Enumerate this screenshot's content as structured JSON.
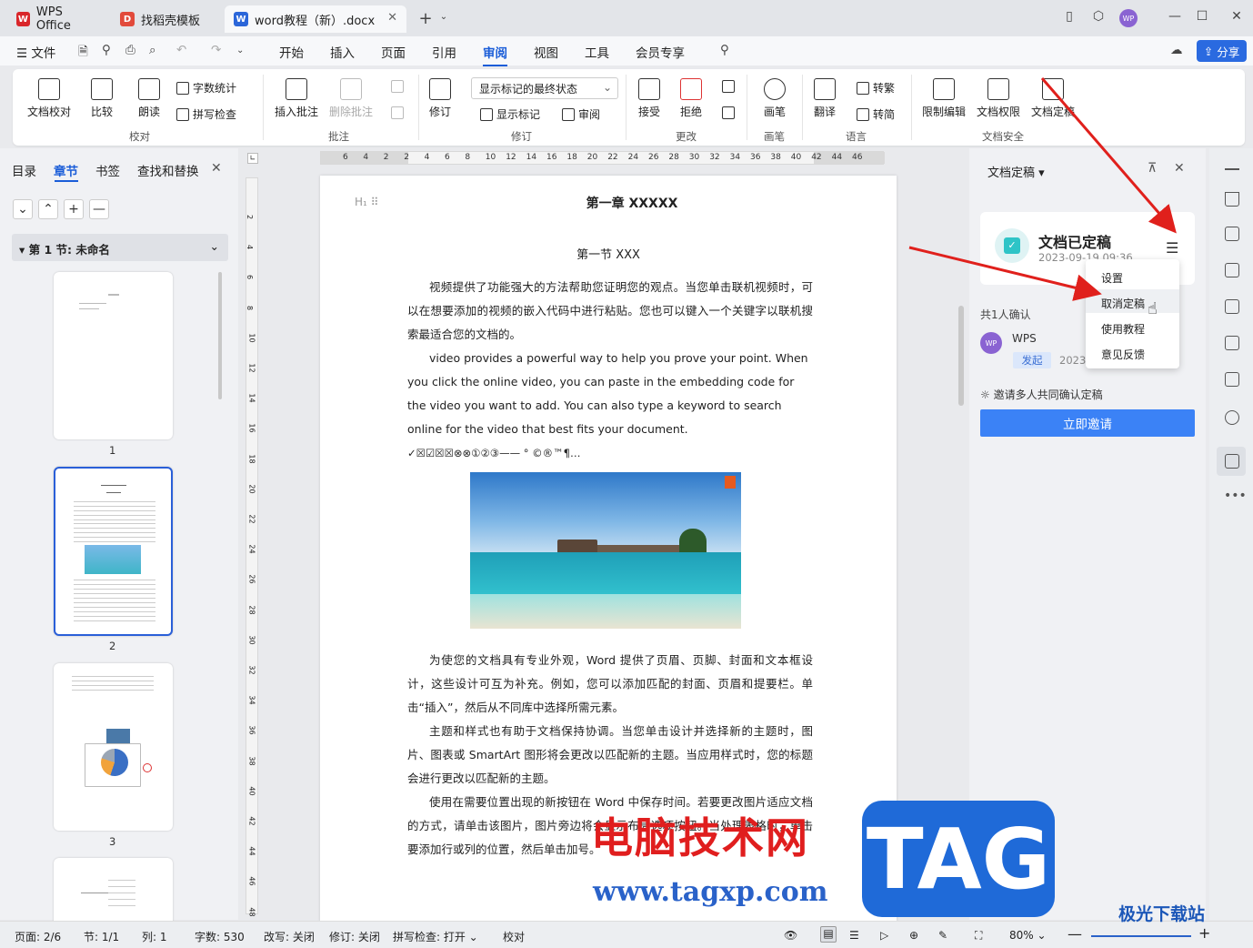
{
  "tabs": [
    {
      "label": "WPS Office",
      "icon": "wps-logo-icon"
    },
    {
      "label": "找稻壳模板",
      "icon": "docer-icon"
    },
    {
      "label": "word教程（新）.docx",
      "icon": "word-doc-icon"
    }
  ],
  "menu": {
    "file": "文件",
    "items": [
      "开始",
      "插入",
      "页面",
      "引用",
      "审阅",
      "视图",
      "工具",
      "会员专享"
    ],
    "active": "审阅",
    "share": "分享"
  },
  "ribbon": {
    "doc_check": "文档校对",
    "compare": "比较",
    "read_aloud": "朗读",
    "word_count": "字数统计",
    "spell_check": "拼写检查",
    "group_proof": "校对",
    "insert_comment": "插入批注",
    "delete_comment": "删除批注",
    "group_comment": "批注",
    "revise": "修订",
    "markup_state": "显示标记的最终状态",
    "show_markup": "显示标记",
    "review": "审阅",
    "group_revise": "修订",
    "accept": "接受",
    "reject": "拒绝",
    "group_change": "更改",
    "ink": "画笔",
    "group_ink": "画笔",
    "translate": "翻译",
    "trad": "转繁",
    "simp": "转简",
    "group_lang": "语言",
    "restrict": "限制编辑",
    "permission": "文档权限",
    "finalize": "文档定稿",
    "group_security": "文档安全"
  },
  "left": {
    "tabs": [
      "目录",
      "章节",
      "书签",
      "查找和替换"
    ],
    "active_tab": "章节",
    "section": "第 1 节: 未命名",
    "pages": [
      "1",
      "2",
      "3"
    ]
  },
  "ruler": {
    "h_ticks": [
      "6",
      "4",
      "2",
      "2",
      "4",
      "6",
      "8",
      "10",
      "12",
      "14",
      "16",
      "18",
      "20",
      "22",
      "24",
      "26",
      "28",
      "30",
      "32",
      "34",
      "36",
      "38",
      "40",
      "42",
      "44",
      "46"
    ],
    "v_ticks": [
      "2",
      "4",
      "6",
      "8",
      "10",
      "12",
      "14",
      "16",
      "18",
      "20",
      "22",
      "24",
      "26",
      "28",
      "30",
      "32",
      "34",
      "36",
      "38",
      "40",
      "42",
      "44",
      "46",
      "48"
    ]
  },
  "doc": {
    "chapter": "第一章  XXXXX",
    "section": "第一节  XXX",
    "p1": "视频提供了功能强大的方法帮助您证明您的观点。当您单击联机视频时，可以在想要添加的视频的嵌入代码中进行粘贴。您也可以键入一个关键字以联机搜索最适合您的文档的。",
    "p2": "video provides a powerful way to help you prove your point. When you click the online video, you can paste in the embedding code for the video you want to add. You can also type a keyword to search online for the video that best fits your document.",
    "symbols": "✓☒☑☒☒⊗⊗①②③——   °  ©®™¶…",
    "p3": "为使您的文档具有专业外观，Word 提供了页眉、页脚、封面和文本框设计，这些设计可互为补充。例如，您可以添加匹配的封面、页眉和提要栏。单击“插入”，然后从不同库中选择所需元素。",
    "p4": "主题和样式也有助于文档保持协调。当您单击设计并选择新的主题时，图片、图表或 SmartArt 图形将会更改以匹配新的主题。当应用样式时，您的标题会进行更改以匹配新的主题。",
    "p5": "使用在需要位置出现的新按钮在 Word 中保存时间。若要更改图片适应文档的方式，请单击该图片，图片旁边将会显示布局选项按钮。当处理表格时，单击要添加行或列的位置，然后单击加号。"
  },
  "panel": {
    "title": "文档定稿",
    "status": "文档已定稿",
    "date": "2023-09-19 09:36",
    "confirm_count": "共1人确认",
    "user_avatar": "WP",
    "user": "WPS",
    "role": "发起",
    "user_date": "2023",
    "invite_tip": "邀请多人共同确认定稿",
    "invite_btn": "立即邀请",
    "menu": [
      "设置",
      "取消定稿",
      "使用教程",
      "意见反馈"
    ]
  },
  "status": {
    "page": "页面: 2/6",
    "section": "节: 1/1",
    "col": "列: 1",
    "words": "字数: 530",
    "overtype": "改写: 关闭",
    "track": "修订: 关闭",
    "spell": "拼写检查: 打开",
    "proof": "校对",
    "zoom": "80%"
  },
  "watermark": {
    "cn": "电脑技术网",
    "url": "www.tagxp.com",
    "tag": "TAG",
    "site": "极光下载站"
  },
  "colors": {
    "accent": "#1a5dd8",
    "button": "#3b82f6",
    "arrow": "#e0201c"
  }
}
